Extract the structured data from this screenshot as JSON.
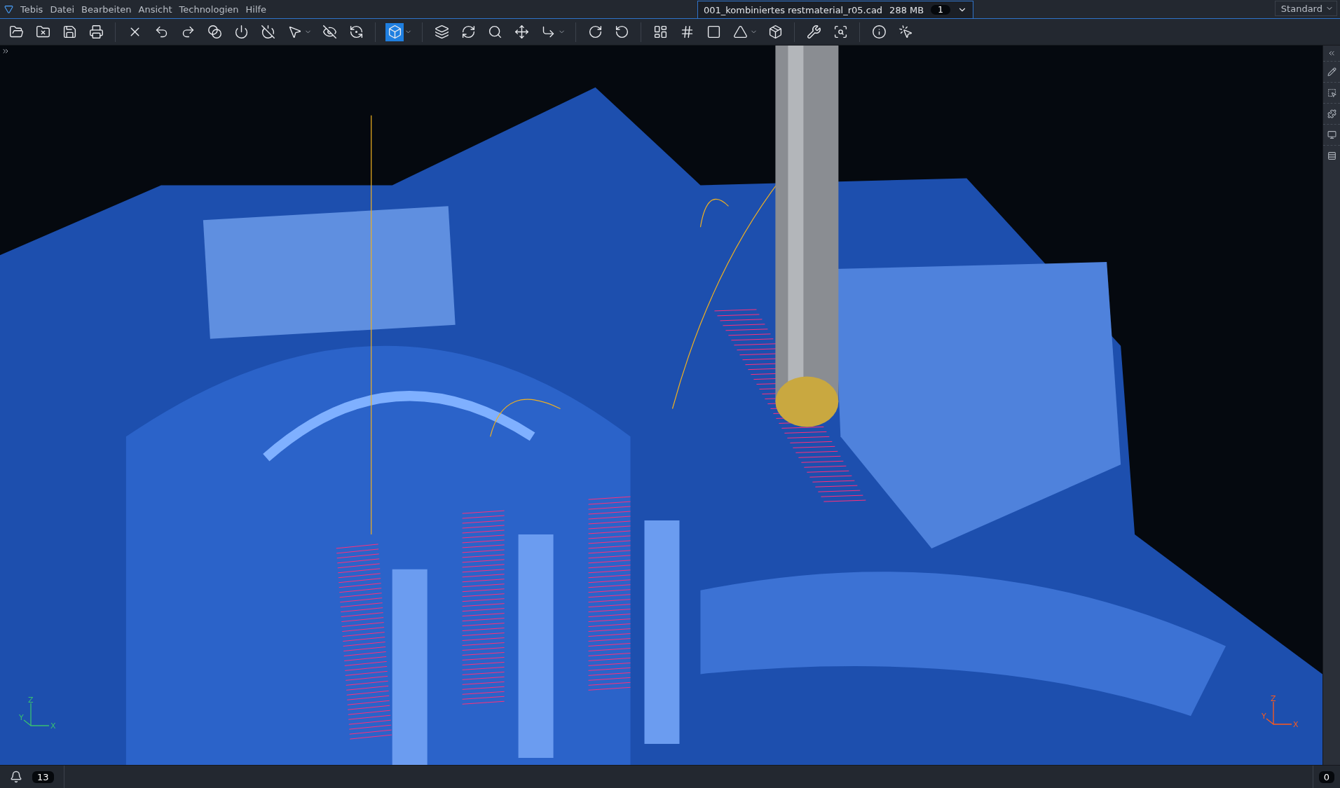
{
  "menu": {
    "items": [
      "Tebis",
      "Datei",
      "Bearbeiten",
      "Ansicht",
      "Technologien",
      "Hilfe"
    ]
  },
  "document_tab": {
    "title": "001_kombiniertes restmaterial_r05.cad",
    "size": "288 MB",
    "window_count": "1",
    "selected": true
  },
  "layout_select": {
    "value": "Standard"
  },
  "toolbar_groups": [
    [
      {
        "selected": false,
        "dropdown": false
      },
      {
        "selected": false,
        "dropdown": false
      },
      {
        "selected": false,
        "dropdown": false
      },
      {
        "selected": false,
        "dropdown": false
      }
    ],
    [
      {
        "selected": false,
        "dropdown": false
      },
      {
        "selected": false,
        "dropdown": false
      },
      {
        "selected": false,
        "dropdown": false
      },
      {
        "selected": false,
        "dropdown": false
      },
      {
        "selected": false,
        "dropdown": false
      },
      {
        "selected": false,
        "dropdown": false
      },
      {
        "selected": false,
        "dropdown": true
      },
      {
        "selected": false,
        "dropdown": false
      },
      {
        "selected": false,
        "dropdown": false
      }
    ],
    [
      {
        "selected": true,
        "dropdown": true
      }
    ],
    [
      {
        "selected": false,
        "dropdown": false
      },
      {
        "selected": false,
        "dropdown": false
      },
      {
        "selected": false,
        "dropdown": false
      },
      {
        "selected": false,
        "dropdown": false
      },
      {
        "selected": false,
        "dropdown": true
      }
    ],
    [
      {
        "selected": false,
        "dropdown": false
      },
      {
        "selected": false,
        "dropdown": false
      }
    ],
    [
      {
        "selected": false,
        "dropdown": false
      },
      {
        "selected": false,
        "dropdown": false
      },
      {
        "selected": false,
        "dropdown": false
      },
      {
        "selected": false,
        "dropdown": true
      },
      {
        "selected": false,
        "dropdown": false
      }
    ],
    [
      {
        "selected": false,
        "dropdown": false
      },
      {
        "selected": false,
        "dropdown": false
      }
    ],
    [
      {
        "selected": false,
        "dropdown": false
      },
      {
        "selected": false,
        "dropdown": false
      }
    ]
  ],
  "viewport": {
    "axes": [
      {
        "z": "Z",
        "y": "Y",
        "x": "X"
      },
      {
        "z": "Z",
        "y": "Y",
        "x": "X"
      }
    ]
  },
  "status_bar": {
    "notification_count": "13",
    "right_count": "0"
  }
}
